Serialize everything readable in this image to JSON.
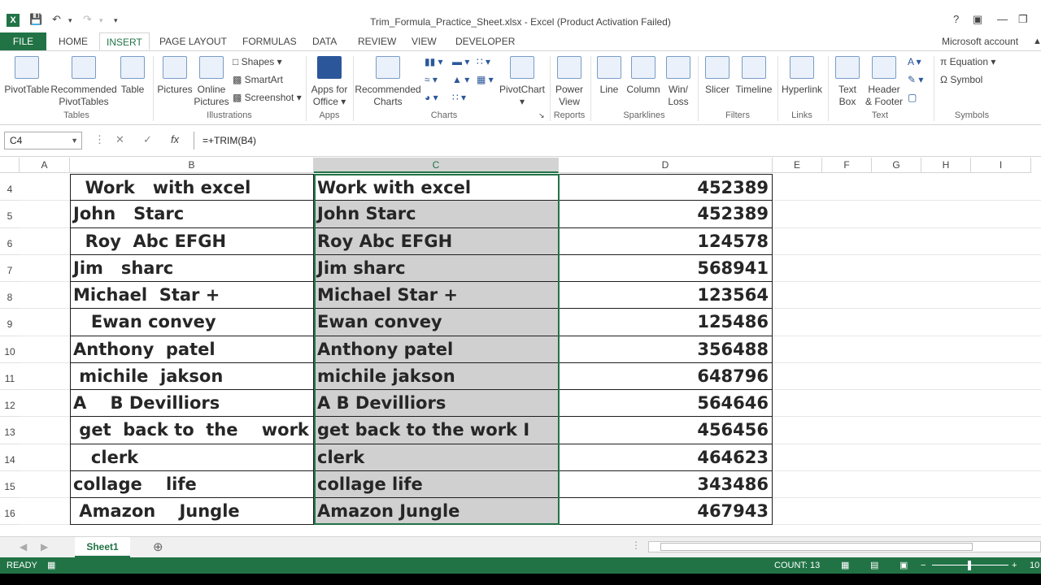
{
  "window": {
    "title": "Trim_Formula_Practice_Sheet.xlsx - Excel (Product Activation Failed)",
    "account": "Microsoft account"
  },
  "tabs": [
    "FILE",
    "HOME",
    "INSERT",
    "PAGE LAYOUT",
    "FORMULAS",
    "DATA",
    "REVIEW",
    "VIEW",
    "DEVELOPER"
  ],
  "ribbon": {
    "tables": {
      "pivottable": "PivotTable",
      "recommended": "Recommended",
      "recommended2": "PivotTables",
      "table": "Table",
      "group": "Tables"
    },
    "illustrations": {
      "pictures": "Pictures",
      "online": "Online",
      "online2": "Pictures",
      "shapes": "Shapes",
      "smartart": "SmartArt",
      "screenshot": "Screenshot",
      "group": "Illustrations"
    },
    "apps": {
      "apps": "Apps for",
      "apps2": "Office",
      "group": "Apps"
    },
    "charts": {
      "recommended": "Recommended",
      "recommended2": "Charts",
      "pivotchart": "PivotChart",
      "group": "Charts"
    },
    "reports": {
      "power": "Power",
      "power2": "View",
      "group": "Reports"
    },
    "sparklines": {
      "line": "Line",
      "column": "Column",
      "winloss": "Win/",
      "winloss2": "Loss",
      "group": "Sparklines"
    },
    "filters": {
      "slicer": "Slicer",
      "timeline": "Timeline",
      "group": "Filters"
    },
    "links": {
      "hyperlink": "Hyperlink",
      "group": "Links"
    },
    "text": {
      "textbox": "Text",
      "textbox2": "Box",
      "header": "Header",
      "header2": "& Footer",
      "group": "Text"
    },
    "symbols": {
      "equation": "Equation",
      "symbol": "Symbol",
      "group": "Symbols"
    }
  },
  "formula_bar": {
    "namebox": "C4",
    "formula": "=+TRIM(B4)"
  },
  "columns": [
    "A",
    "B",
    "C",
    "D",
    "E",
    "F",
    "G",
    "H",
    "I"
  ],
  "rows": [
    {
      "n": "4",
      "b": "  Work   with excel",
      "c": "Work with excel",
      "d": "452389"
    },
    {
      "n": "5",
      "b": "John   Starc",
      "c": "John Starc",
      "d": "452389"
    },
    {
      "n": "6",
      "b": "  Roy  Abc EFGH",
      "c": "Roy Abc EFGH",
      "d": "124578"
    },
    {
      "n": "7",
      "b": "Jim   sharc",
      "c": "Jim sharc",
      "d": "568941"
    },
    {
      "n": "8",
      "b": "Michael  Star +",
      "c": "Michael Star +",
      "d": "123564"
    },
    {
      "n": "9",
      "b": "   Ewan convey",
      "c": "Ewan convey",
      "d": "125486"
    },
    {
      "n": "10",
      "b": "Anthony  patel",
      "c": "Anthony patel",
      "d": "356488"
    },
    {
      "n": "11",
      "b": " michile  jakson",
      "c": "michile jakson",
      "d": "648796"
    },
    {
      "n": "12",
      "b": "A    B Devilliors",
      "c": "A B Devilliors",
      "d": "564646"
    },
    {
      "n": "13",
      "b": " get  back to  the    work  I",
      "c": "get back to the work I",
      "d": "456456"
    },
    {
      "n": "14",
      "b": "   clerk",
      "c": "clerk",
      "d": "464623"
    },
    {
      "n": "15",
      "b": "collage    life",
      "c": "collage life",
      "d": "343486"
    },
    {
      "n": "16",
      "b": " Amazon    Jungle",
      "c": "Amazon Jungle",
      "d": "467943"
    }
  ],
  "sheet": {
    "name": "Sheet1"
  },
  "status": {
    "mode": "READY",
    "count": "COUNT: 13",
    "zoom": "10"
  },
  "colors": {
    "accent": "#217346",
    "selection": "#d0d0d0"
  }
}
